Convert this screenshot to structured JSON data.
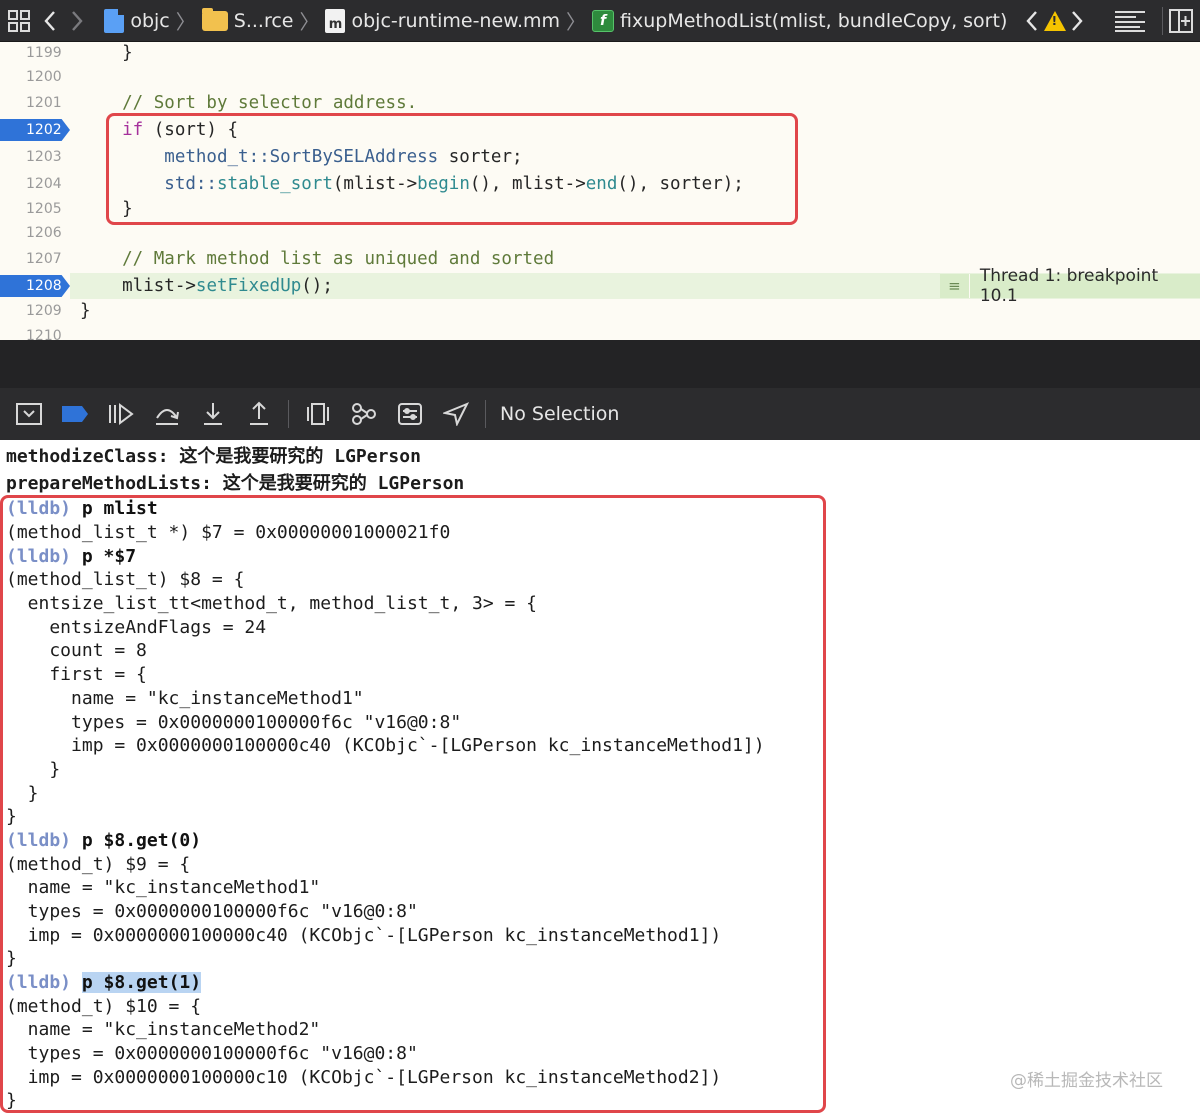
{
  "jumpbar": {
    "crumbs": [
      "objc",
      "S...rce",
      "objc-runtime-new.mm",
      "fixupMethodList(mlist, bundleCopy, sort)"
    ],
    "icons": [
      "grid-icon",
      "back-icon",
      "forward-icon",
      "app-icon",
      "folder-icon",
      "objc-file-icon",
      "function-icon",
      "warning-icon",
      "minimap-icon",
      "add-editor-icon"
    ]
  },
  "editor": {
    "lines": [
      {
        "num": "1199",
        "breakpoint": false
      },
      {
        "num": "1200",
        "breakpoint": false
      },
      {
        "num": "1201",
        "breakpoint": false
      },
      {
        "num": "1202",
        "breakpoint": true
      },
      {
        "num": "1203",
        "breakpoint": false
      },
      {
        "num": "1204",
        "breakpoint": false
      },
      {
        "num": "1205",
        "breakpoint": false
      },
      {
        "num": "1206",
        "breakpoint": false
      },
      {
        "num": "1207",
        "breakpoint": false
      },
      {
        "num": "1208",
        "breakpoint": true
      },
      {
        "num": "1209",
        "breakpoint": false
      },
      {
        "num": "1210",
        "breakpoint": false
      }
    ],
    "code": {
      "l1199": "    }",
      "l1201_comment": "    // Sort by selector address.",
      "l1202_kw": "    if",
      "l1202_rest": " (sort) {",
      "l1203_type": "        method_t::SortBySELAddress",
      "l1203_rest": " sorter;",
      "l1204_type": "        std::",
      "l1204_fn1": "stable_sort",
      "l1204_a": "(mlist->",
      "l1204_fn2": "begin",
      "l1204_b": "(), mlist->",
      "l1204_fn3": "end",
      "l1204_c": "(), sorter);",
      "l1205": "    }",
      "l1207_comment": "    // Mark method list as uniqued and sorted",
      "l1208_a": "    mlist->",
      "l1208_fn": "setFixedUp",
      "l1208_b": "();",
      "l1209": "}"
    },
    "thread_badge": "Thread 1: breakpoint 10.1"
  },
  "debugbar": {
    "icons": [
      "hide-debug-area-icon",
      "breakpoint-toggle-icon",
      "continue-icon",
      "step-over-icon",
      "step-into-icon",
      "step-out-icon",
      "view-hierarchy-icon",
      "memory-graph-icon",
      "environment-overrides-icon",
      "simulate-location-icon"
    ],
    "status": "No Selection"
  },
  "console": {
    "lines": [
      {
        "type": "bold",
        "text": "methodizeClass: 这个是我要研究的 LGPerson"
      },
      {
        "type": "bold",
        "text": "prepareMethodLists: 这个是我要研究的 LGPerson"
      },
      {
        "type": "prompt",
        "prompt": "(lldb)",
        "cmd": " p mlist"
      },
      {
        "type": "out",
        "text": "(method_list_t *) $7 = 0x00000001000021f0"
      },
      {
        "type": "prompt",
        "prompt": "(lldb)",
        "cmd": " p *$7"
      },
      {
        "type": "out",
        "text": "(method_list_t) $8 = {"
      },
      {
        "type": "out",
        "text": "  entsize_list_tt<method_t, method_list_t, 3> = {"
      },
      {
        "type": "out",
        "text": "    entsizeAndFlags = 24"
      },
      {
        "type": "out",
        "text": "    count = 8"
      },
      {
        "type": "out",
        "text": "    first = {"
      },
      {
        "type": "out",
        "text": "      name = \"kc_instanceMethod1\""
      },
      {
        "type": "out",
        "text": "      types = 0x0000000100000f6c \"v16@0:8\""
      },
      {
        "type": "out",
        "text": "      imp = 0x0000000100000c40 (KCObjc`-[LGPerson kc_instanceMethod1])"
      },
      {
        "type": "out",
        "text": "    }"
      },
      {
        "type": "out",
        "text": "  }"
      },
      {
        "type": "out",
        "text": "}"
      },
      {
        "type": "prompt",
        "prompt": "(lldb)",
        "cmd": " p $8.get(0)"
      },
      {
        "type": "out",
        "text": "(method_t) $9 = {"
      },
      {
        "type": "out",
        "text": "  name = \"kc_instanceMethod1\""
      },
      {
        "type": "out",
        "text": "  types = 0x0000000100000f6c \"v16@0:8\""
      },
      {
        "type": "out",
        "text": "  imp = 0x0000000100000c40 (KCObjc`-[LGPerson kc_instanceMethod1])"
      },
      {
        "type": "out",
        "text": "}"
      },
      {
        "type": "prompt-sel",
        "prompt": "(lldb)",
        "cmd": "p $8.get(1)"
      },
      {
        "type": "out",
        "text": "(method_t) $10 = {"
      },
      {
        "type": "out",
        "text": "  name = \"kc_instanceMethod2\""
      },
      {
        "type": "out",
        "text": "  types = 0x0000000100000f6c \"v16@0:8\""
      },
      {
        "type": "out",
        "text": "  imp = 0x0000000100000c10 (KCObjc`-[LGPerson kc_instanceMethod2])"
      },
      {
        "type": "out",
        "text": "}"
      }
    ],
    "watermark": "@稀土掘金技术社区"
  },
  "colors": {
    "breakpoint": "#2f73d8",
    "highlight_box": "#e0464a",
    "current_line": "#e9f3de",
    "lldb_prompt": "#7a8fc7"
  }
}
